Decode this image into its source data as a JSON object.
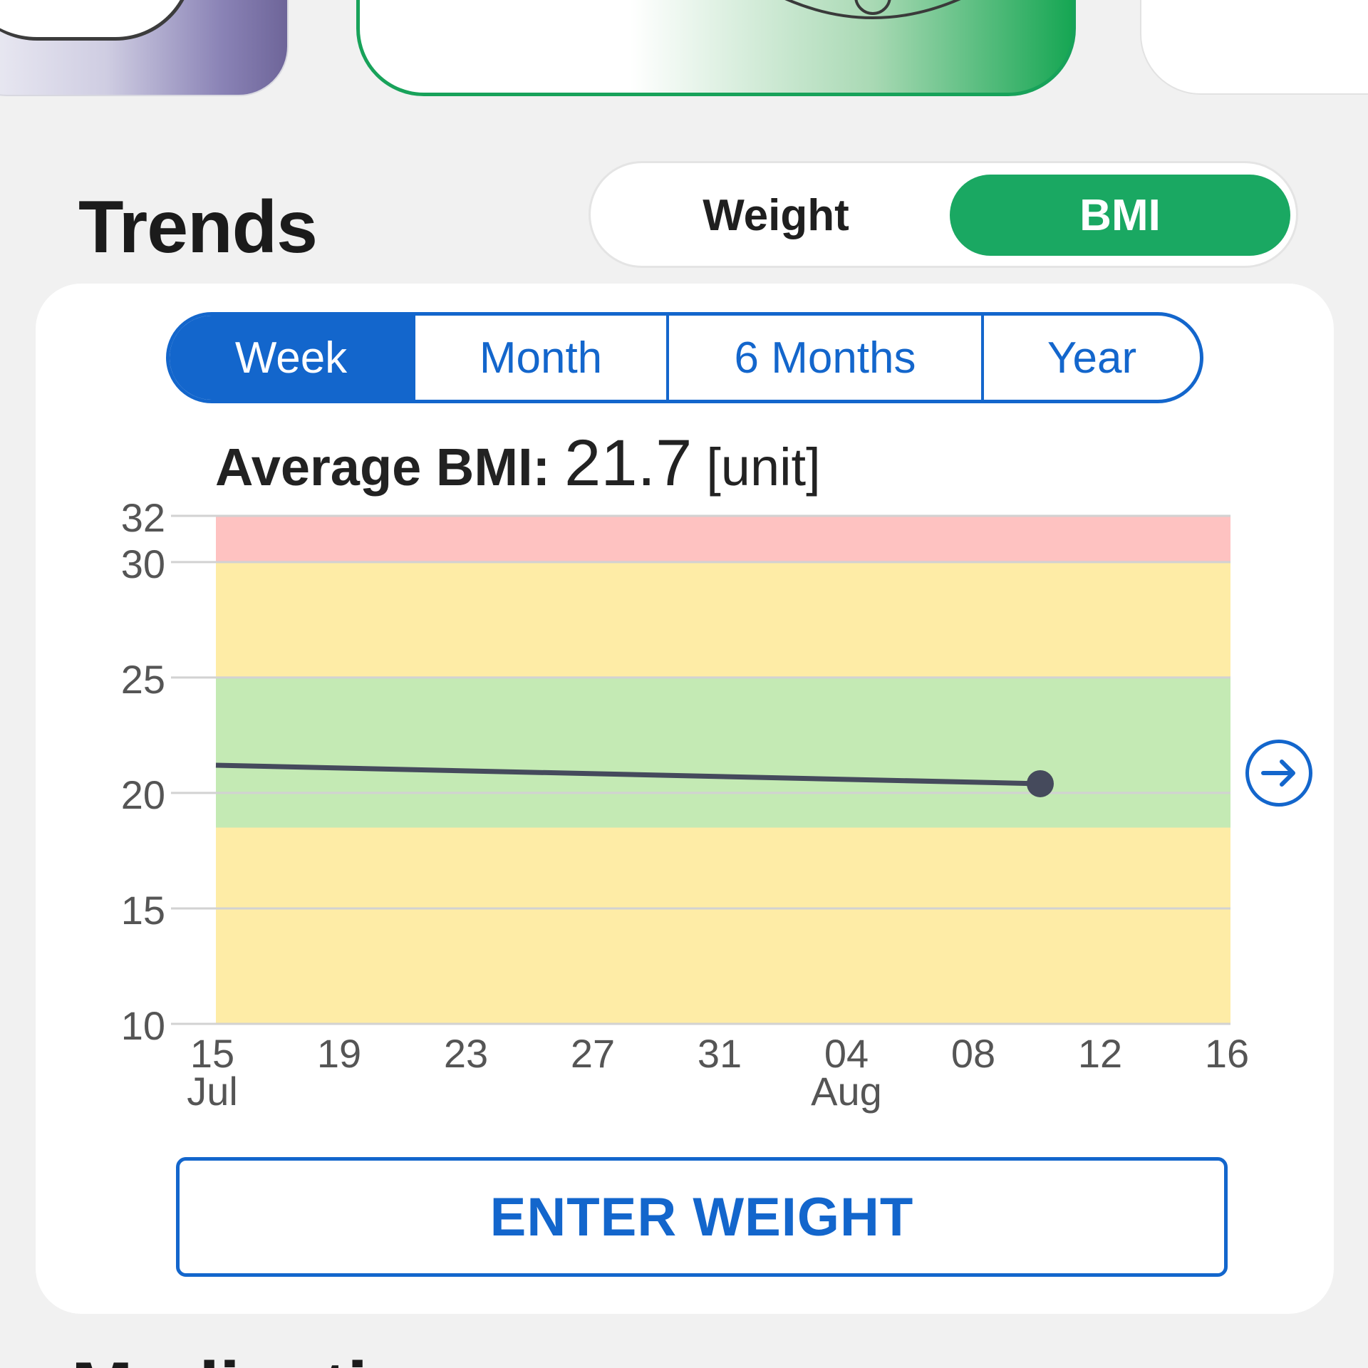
{
  "section": {
    "title": "Trends"
  },
  "metric_toggle": {
    "options": [
      "Weight",
      "BMI"
    ],
    "selected": "BMI"
  },
  "range_tabs": {
    "options": [
      "Week",
      "Month",
      "6 Months",
      "Year"
    ],
    "selected": "Week"
  },
  "average": {
    "label": "Average BMI:",
    "value": "21.7",
    "unit": "[unit]"
  },
  "chart_data": {
    "type": "line",
    "y_ticks": [
      10,
      15,
      20,
      25,
      30,
      32
    ],
    "ylim": [
      10,
      32
    ],
    "x_ticks": [
      {
        "day": "15",
        "month": "Jul"
      },
      {
        "day": "19",
        "month": ""
      },
      {
        "day": "23",
        "month": ""
      },
      {
        "day": "27",
        "month": ""
      },
      {
        "day": "31",
        "month": ""
      },
      {
        "day": "04",
        "month": "Aug"
      },
      {
        "day": "08",
        "month": ""
      },
      {
        "day": "12",
        "month": ""
      },
      {
        "day": "16",
        "month": ""
      }
    ],
    "xlim": [
      "2023-07-15",
      "2023-08-16"
    ],
    "bands": [
      {
        "from": 10,
        "to": 18.5,
        "color": "#feeca6"
      },
      {
        "from": 18.5,
        "to": 25,
        "color": "#c4eab4"
      },
      {
        "from": 25,
        "to": 30,
        "color": "#feeca6"
      },
      {
        "from": 30,
        "to": 32,
        "color": "#fec2c1"
      }
    ],
    "series": [
      {
        "line_color": "#454a5c",
        "points": [
          {
            "x": "2023-07-15",
            "y": 21.2
          },
          {
            "x": "2023-08-10",
            "y": 20.4
          }
        ]
      }
    ],
    "grid": true
  },
  "actions": {
    "enter_weight": "ENTER WEIGHT"
  },
  "next_section": {
    "title": "Medications"
  },
  "colors": {
    "accent_blue": "#1366cc",
    "accent_green": "#1aa862",
    "background": "#f1f1f1"
  }
}
